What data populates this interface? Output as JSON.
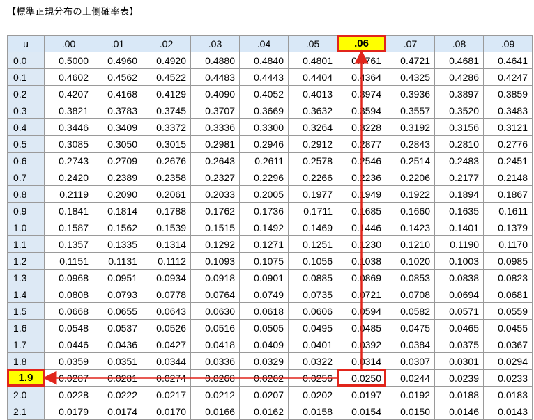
{
  "title": "【標準正規分布の上側確率表】",
  "header": [
    "u",
    ".00",
    ".01",
    ".02",
    ".03",
    ".04",
    ".05",
    ".06",
    ".07",
    ".08",
    ".09"
  ],
  "highlight": {
    "row_label": "1.9",
    "column_label": ".06",
    "value": "0.0250",
    "color": "#e1251b",
    "fill": "#ffff00"
  },
  "rows": [
    {
      "u": "0.0",
      "v": [
        "0.5000",
        "0.4960",
        "0.4920",
        "0.4880",
        "0.4840",
        "0.4801",
        "0.4761",
        "0.4721",
        "0.4681",
        "0.4641"
      ]
    },
    {
      "u": "0.1",
      "v": [
        "0.4602",
        "0.4562",
        "0.4522",
        "0.4483",
        "0.4443",
        "0.4404",
        "0.4364",
        "0.4325",
        "0.4286",
        "0.4247"
      ]
    },
    {
      "u": "0.2",
      "v": [
        "0.4207",
        "0.4168",
        "0.4129",
        "0.4090",
        "0.4052",
        "0.4013",
        "0.3974",
        "0.3936",
        "0.3897",
        "0.3859"
      ]
    },
    {
      "u": "0.3",
      "v": [
        "0.3821",
        "0.3783",
        "0.3745",
        "0.3707",
        "0.3669",
        "0.3632",
        "0.3594",
        "0.3557",
        "0.3520",
        "0.3483"
      ]
    },
    {
      "u": "0.4",
      "v": [
        "0.3446",
        "0.3409",
        "0.3372",
        "0.3336",
        "0.3300",
        "0.3264",
        "0.3228",
        "0.3192",
        "0.3156",
        "0.3121"
      ]
    },
    {
      "u": "0.5",
      "v": [
        "0.3085",
        "0.3050",
        "0.3015",
        "0.2981",
        "0.2946",
        "0.2912",
        "0.2877",
        "0.2843",
        "0.2810",
        "0.2776"
      ]
    },
    {
      "u": "0.6",
      "v": [
        "0.2743",
        "0.2709",
        "0.2676",
        "0.2643",
        "0.2611",
        "0.2578",
        "0.2546",
        "0.2514",
        "0.2483",
        "0.2451"
      ]
    },
    {
      "u": "0.7",
      "v": [
        "0.2420",
        "0.2389",
        "0.2358",
        "0.2327",
        "0.2296",
        "0.2266",
        "0.2236",
        "0.2206",
        "0.2177",
        "0.2148"
      ]
    },
    {
      "u": "0.8",
      "v": [
        "0.2119",
        "0.2090",
        "0.2061",
        "0.2033",
        "0.2005",
        "0.1977",
        "0.1949",
        "0.1922",
        "0.1894",
        "0.1867"
      ]
    },
    {
      "u": "0.9",
      "v": [
        "0.1841",
        "0.1814",
        "0.1788",
        "0.1762",
        "0.1736",
        "0.1711",
        "0.1685",
        "0.1660",
        "0.1635",
        "0.1611"
      ]
    },
    {
      "u": "1.0",
      "v": [
        "0.1587",
        "0.1562",
        "0.1539",
        "0.1515",
        "0.1492",
        "0.1469",
        "0.1446",
        "0.1423",
        "0.1401",
        "0.1379"
      ]
    },
    {
      "u": "1.1",
      "v": [
        "0.1357",
        "0.1335",
        "0.1314",
        "0.1292",
        "0.1271",
        "0.1251",
        "0.1230",
        "0.1210",
        "0.1190",
        "0.1170"
      ]
    },
    {
      "u": "1.2",
      "v": [
        "0.1151",
        "0.1131",
        "0.1112",
        "0.1093",
        "0.1075",
        "0.1056",
        "0.1038",
        "0.1020",
        "0.1003",
        "0.0985"
      ]
    },
    {
      "u": "1.3",
      "v": [
        "0.0968",
        "0.0951",
        "0.0934",
        "0.0918",
        "0.0901",
        "0.0885",
        "0.0869",
        "0.0853",
        "0.0838",
        "0.0823"
      ]
    },
    {
      "u": "1.4",
      "v": [
        "0.0808",
        "0.0793",
        "0.0778",
        "0.0764",
        "0.0749",
        "0.0735",
        "0.0721",
        "0.0708",
        "0.0694",
        "0.0681"
      ]
    },
    {
      "u": "1.5",
      "v": [
        "0.0668",
        "0.0655",
        "0.0643",
        "0.0630",
        "0.0618",
        "0.0606",
        "0.0594",
        "0.0582",
        "0.0571",
        "0.0559"
      ]
    },
    {
      "u": "1.6",
      "v": [
        "0.0548",
        "0.0537",
        "0.0526",
        "0.0516",
        "0.0505",
        "0.0495",
        "0.0485",
        "0.0475",
        "0.0465",
        "0.0455"
      ]
    },
    {
      "u": "1.7",
      "v": [
        "0.0446",
        "0.0436",
        "0.0427",
        "0.0418",
        "0.0409",
        "0.0401",
        "0.0392",
        "0.0384",
        "0.0375",
        "0.0367"
      ]
    },
    {
      "u": "1.8",
      "v": [
        "0.0359",
        "0.0351",
        "0.0344",
        "0.0336",
        "0.0329",
        "0.0322",
        "0.0314",
        "0.0307",
        "0.0301",
        "0.0294"
      ]
    },
    {
      "u": "1.9",
      "v": [
        "0.0287",
        "0.0281",
        "0.0274",
        "0.0268",
        "0.0262",
        "0.0256",
        "0.0250",
        "0.0244",
        "0.0239",
        "0.0233"
      ]
    },
    {
      "u": "2.0",
      "v": [
        "0.0228",
        "0.0222",
        "0.0217",
        "0.0212",
        "0.0207",
        "0.0202",
        "0.0197",
        "0.0192",
        "0.0188",
        "0.0183"
      ]
    },
    {
      "u": "2.1",
      "v": [
        "0.0179",
        "0.0174",
        "0.0170",
        "0.0166",
        "0.0162",
        "0.0158",
        "0.0154",
        "0.0150",
        "0.0146",
        "0.0143"
      ]
    }
  ]
}
